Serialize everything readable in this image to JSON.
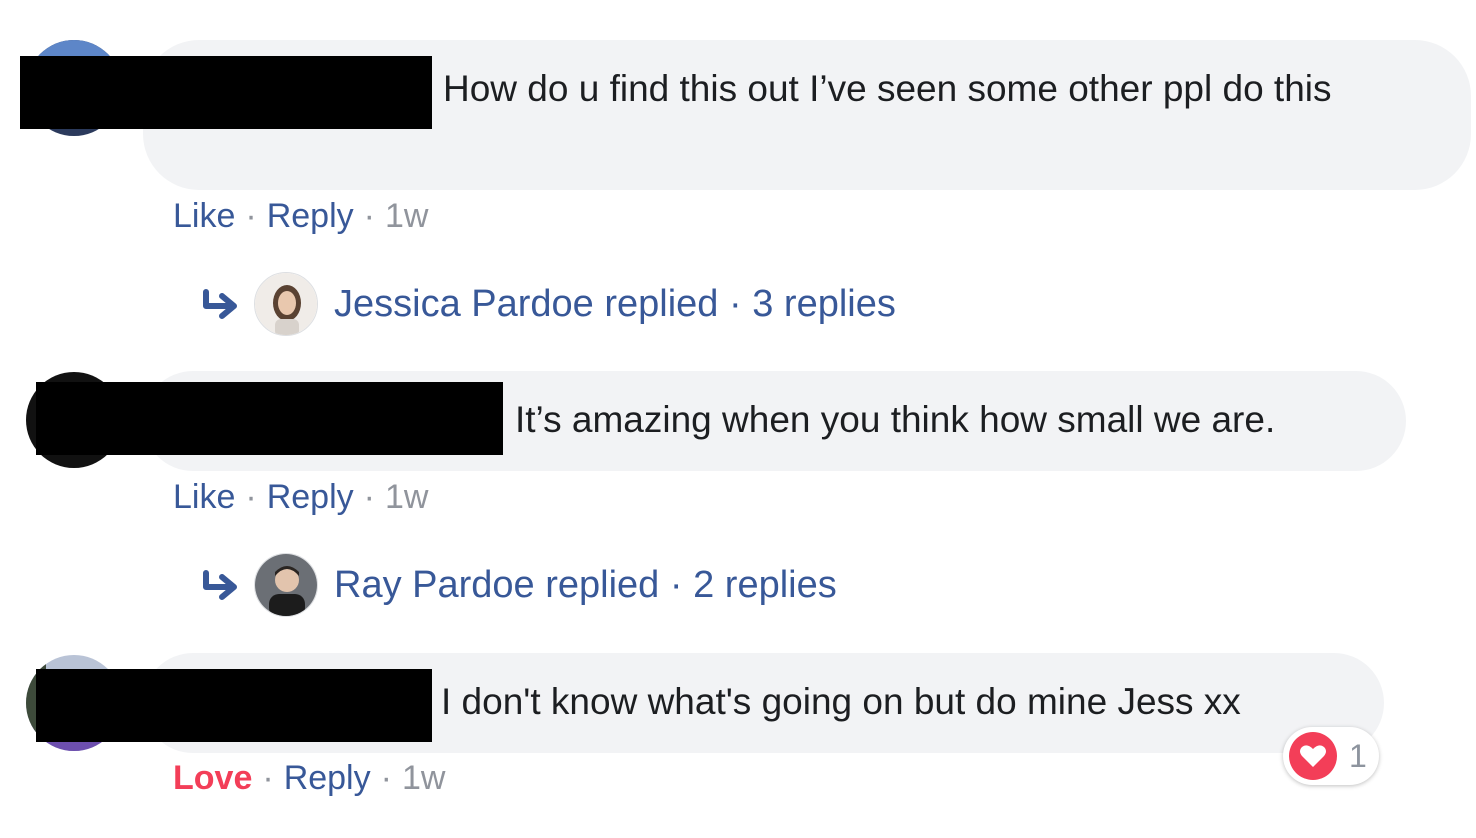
{
  "comments": [
    {
      "text": "How do u find this out I’ve seen some other ppl do this",
      "actions": {
        "like": "Like",
        "reply": "Reply",
        "time": "1w",
        "sep": "·"
      },
      "replies_summary": {
        "name": "Jessica Pardoe replied",
        "count": "3 replies",
        "sep": "·"
      }
    },
    {
      "text": "It’s amazing when you think how small we are.",
      "actions": {
        "like": "Like",
        "reply": "Reply",
        "time": "1w",
        "sep": "·"
      },
      "replies_summary": {
        "name": "Ray Pardoe replied",
        "count": "2 replies",
        "sep": "·"
      }
    },
    {
      "text": "I don't know what's going on but do mine Jess xx",
      "actions": {
        "like": "Love",
        "reply": "Reply",
        "time": "1w",
        "sep": "·"
      },
      "reaction": {
        "icon": "heart-love-icon",
        "count": "1"
      }
    }
  ],
  "colors": {
    "link": "#385898",
    "love": "#f33e58",
    "meta": "#90949c",
    "bubble": "#f2f3f5"
  }
}
